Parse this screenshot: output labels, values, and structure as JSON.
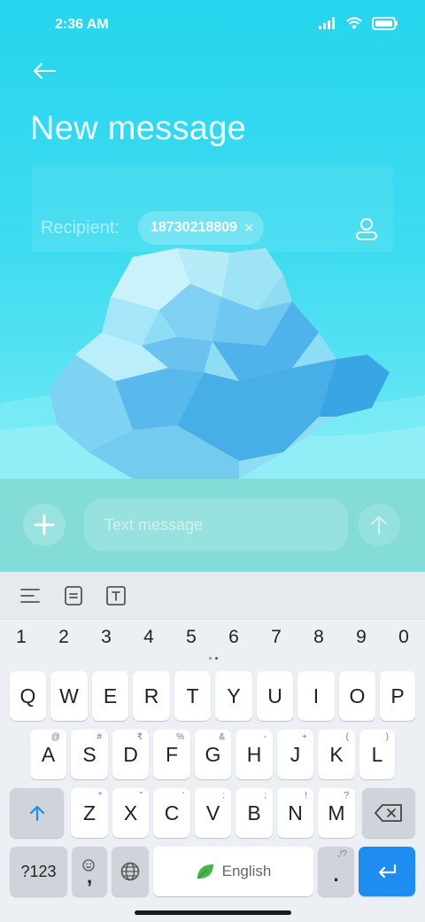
{
  "status_bar": {
    "time": "2:36 AM"
  },
  "header": {
    "title": "New message"
  },
  "recipient": {
    "label": "Recipient:",
    "chip_number": "18730218809",
    "chip_remove": "×"
  },
  "compose": {
    "placeholder": "Text message",
    "value": ""
  },
  "keyboard": {
    "numbers": [
      "1",
      "2",
      "3",
      "4",
      "5",
      "6",
      "7",
      "8",
      "9",
      "0"
    ],
    "row1": [
      "Q",
      "W",
      "E",
      "R",
      "T",
      "Y",
      "U",
      "I",
      "O",
      "P"
    ],
    "row2": [
      {
        "key": "A",
        "sup": "@"
      },
      {
        "key": "S",
        "sup": "#"
      },
      {
        "key": "D",
        "sup": "₹"
      },
      {
        "key": "F",
        "sup": "%"
      },
      {
        "key": "G",
        "sup": "&"
      },
      {
        "key": "H",
        "sup": "-"
      },
      {
        "key": "J",
        "sup": "+"
      },
      {
        "key": "K",
        "sup": "("
      },
      {
        "key": "L",
        "sup": ")"
      }
    ],
    "row3": [
      {
        "key": "Z",
        "sup": "*"
      },
      {
        "key": "X",
        "sup": "\""
      },
      {
        "key": "C",
        "sup": "'"
      },
      {
        "key": "V",
        "sup": ":"
      },
      {
        "key": "B",
        "sup": ";"
      },
      {
        "key": "N",
        "sup": "!"
      },
      {
        "key": "M",
        "sup": "?"
      }
    ],
    "symbols_label": "?123",
    "comma_label": ",",
    "space_label": "English",
    "period_label": ".",
    "period_sup": ",!?"
  },
  "colors": {
    "accent_blue": "#1e8cf0",
    "compose_bar": "#83dcd8",
    "sky_top": "#25d5ee"
  }
}
